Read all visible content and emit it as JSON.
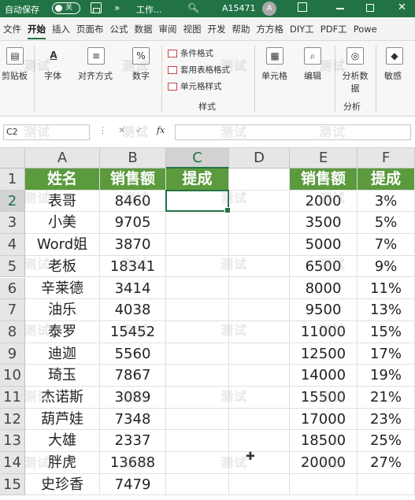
{
  "titlebar": {
    "autosave": "自动保存",
    "toggle": "关",
    "more": "»",
    "doc": "工作...",
    "user": "A15471",
    "avatar": "A"
  },
  "tabs": [
    "文件",
    "开始",
    "插入",
    "页面布",
    "公式",
    "数据",
    "审阅",
    "视图",
    "开发",
    "帮助",
    "方方格",
    "DIY工",
    "PDF工",
    "Powe"
  ],
  "ribbon": {
    "clipboard": "剪贴板",
    "font": "字体",
    "align": "对齐方式",
    "number": "数字",
    "cf_items": [
      "条件格式",
      "套用表格格式",
      "单元格样式"
    ],
    "styles": "样式",
    "cells": "单元格",
    "edit": "编辑",
    "analyze_data": "分析数据",
    "analyze": "分析",
    "sensitivity": "敏感"
  },
  "formula": {
    "namebox": "C2",
    "fx": "fx",
    "value": ""
  },
  "columns": [
    "A",
    "B",
    "C",
    "D",
    "E",
    "F"
  ],
  "rows": [
    "1",
    "2",
    "3",
    "4",
    "5",
    "6",
    "7",
    "8",
    "9",
    "10",
    "11",
    "12",
    "13",
    "14",
    "15"
  ],
  "table_left": {
    "headers": [
      "姓名",
      "销售额",
      "提成"
    ],
    "rows": [
      [
        "表哥",
        "8460"
      ],
      [
        "小美",
        "9705"
      ],
      [
        "Word姐",
        "3870"
      ],
      [
        "老板",
        "18341"
      ],
      [
        "辛莱德",
        "3414"
      ],
      [
        "油乐",
        "4038"
      ],
      [
        "泰罗",
        "15452"
      ],
      [
        "迪迦",
        "5560"
      ],
      [
        "琦玉",
        "7867"
      ],
      [
        "杰诺斯",
        "3089"
      ],
      [
        "葫芦娃",
        "7348"
      ],
      [
        "大雄",
        "2337"
      ],
      [
        "胖虎",
        "13688"
      ],
      [
        "史珍香",
        "7479"
      ]
    ]
  },
  "table_right": {
    "headers": [
      "销售额",
      "提成"
    ],
    "rows": [
      [
        "2000",
        "3%"
      ],
      [
        "3500",
        "5%"
      ],
      [
        "5000",
        "7%"
      ],
      [
        "6500",
        "9%"
      ],
      [
        "8000",
        "11%"
      ],
      [
        "9500",
        "13%"
      ],
      [
        "11000",
        "15%"
      ],
      [
        "12500",
        "17%"
      ],
      [
        "14000",
        "19%"
      ],
      [
        "15500",
        "21%"
      ],
      [
        "17000",
        "23%"
      ],
      [
        "18500",
        "25%"
      ],
      [
        "20000",
        "27%"
      ]
    ]
  },
  "watermark": "测试"
}
